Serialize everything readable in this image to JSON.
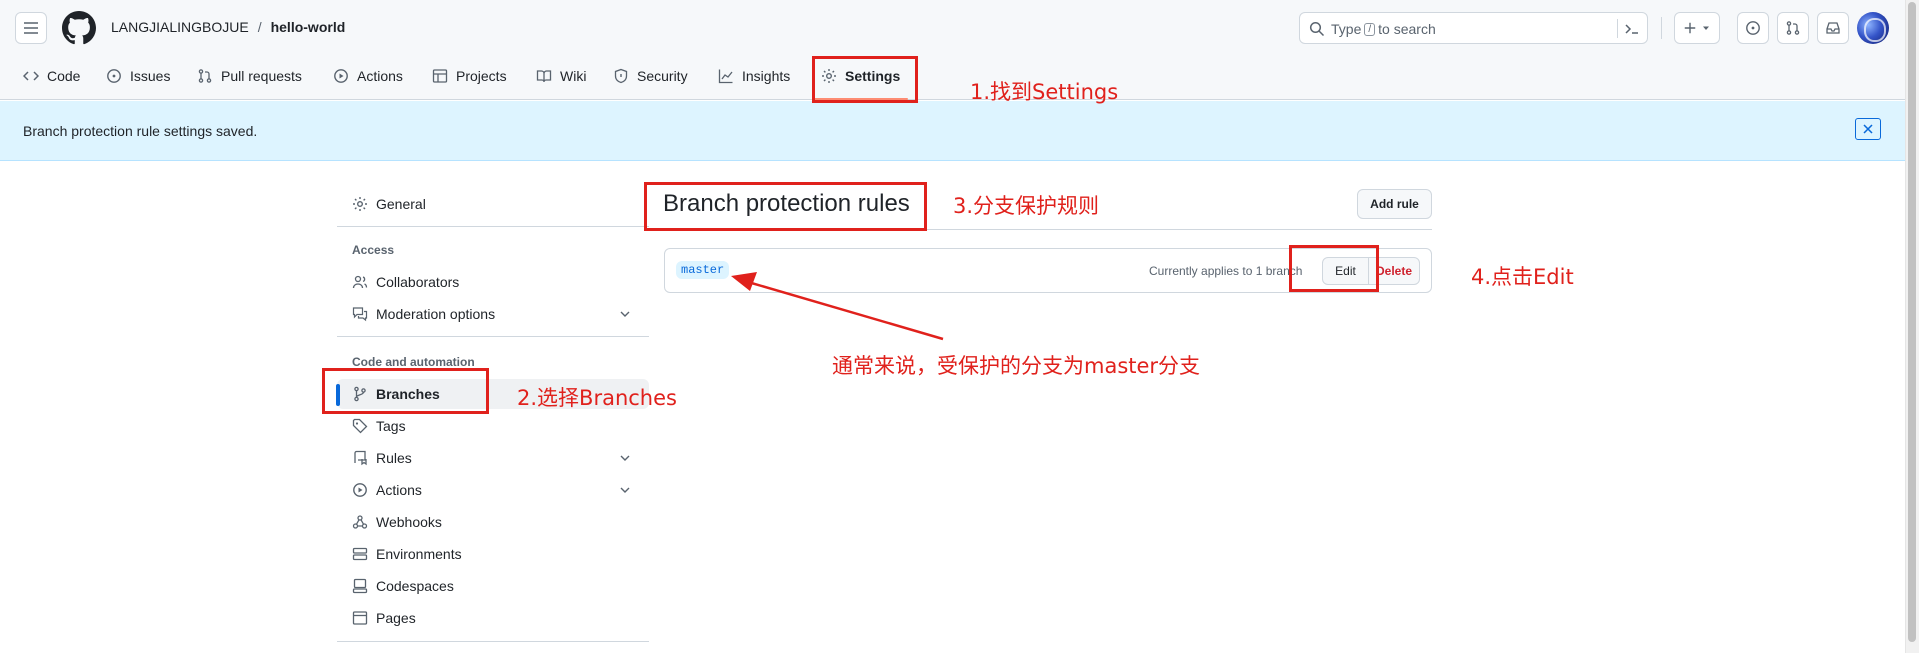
{
  "header": {
    "owner": "LANGJIALINGBOJUE",
    "separator": "/",
    "repo": "hello-world",
    "search_prefix": "Type",
    "search_key": "/",
    "search_suffix": "to search"
  },
  "tabs": [
    {
      "label": "Code",
      "icon": "code-icon"
    },
    {
      "label": "Issues",
      "icon": "issue-opened-icon"
    },
    {
      "label": "Pull requests",
      "icon": "git-pull-request-icon"
    },
    {
      "label": "Actions",
      "icon": "play-icon"
    },
    {
      "label": "Projects",
      "icon": "table-icon"
    },
    {
      "label": "Wiki",
      "icon": "book-icon"
    },
    {
      "label": "Security",
      "icon": "shield-icon"
    },
    {
      "label": "Insights",
      "icon": "graph-icon"
    },
    {
      "label": "Settings",
      "icon": "gear-icon",
      "selected": true
    }
  ],
  "flash": {
    "message": "Branch protection rule settings saved."
  },
  "sidebar": {
    "general": "General",
    "access_heading": "Access",
    "collaborators": "Collaborators",
    "moderation": "Moderation options",
    "code_heading": "Code and automation",
    "branches": "Branches",
    "tags": "Tags",
    "rules": "Rules",
    "actions": "Actions",
    "webhooks": "Webhooks",
    "environments": "Environments",
    "codespaces": "Codespaces",
    "pages": "Pages"
  },
  "main": {
    "title": "Branch protection rules",
    "add_rule": "Add rule",
    "rule": {
      "branch": "master",
      "applies": "Currently applies to 1 branch",
      "edit": "Edit",
      "delete": "Delete"
    }
  },
  "annotations": {
    "step1": "1.找到Settings",
    "step2": "2.选择Branches",
    "step3": "3.分支保护规则",
    "step4": "4.点击Edit",
    "note": "通常来说，受保护的分支为master分支"
  },
  "colors": {
    "annotation": "#e0211c",
    "accent": "#0969da",
    "tab_underline": "#fd8c73",
    "danger": "#cf222e"
  }
}
